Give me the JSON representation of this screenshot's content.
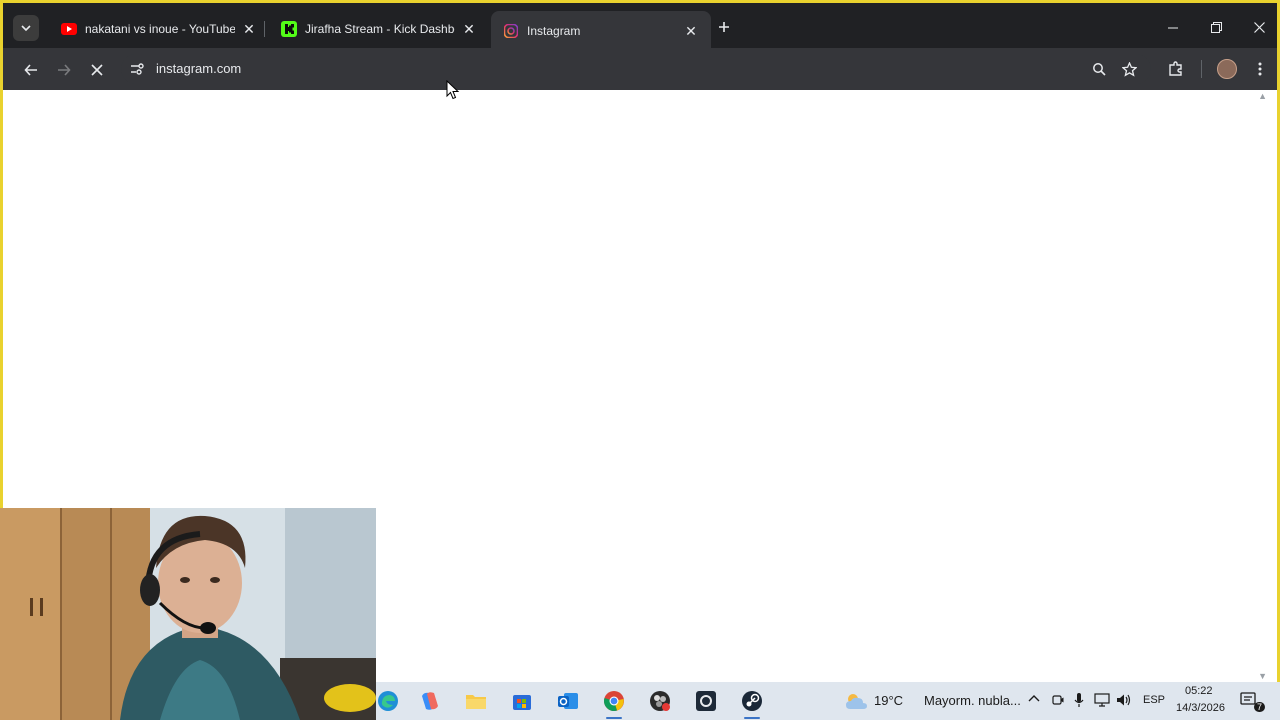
{
  "browser": {
    "tabs": [
      {
        "title": "nakatani vs inoue - YouTube",
        "favicon": "youtube-icon",
        "active": false
      },
      {
        "title": "Jirafha Stream - Kick Dashboard",
        "favicon": "kick-icon",
        "active": false
      },
      {
        "title": "Instagram",
        "favicon": "instagram-icon",
        "active": true
      }
    ],
    "address_bar": {
      "url": "instagram.com"
    },
    "loading": true
  },
  "taskbar": {
    "weather": {
      "temp": "19°C",
      "desc": "Mayorm. nubla..."
    },
    "language": "ESP",
    "time": "05:22",
    "date": "14/3/2026",
    "notifications": "7"
  },
  "colors": {
    "frame": "#e9d22e",
    "tabstrip": "#202124",
    "toolbar": "#35363a",
    "taskbar": "#dfe6ee"
  }
}
